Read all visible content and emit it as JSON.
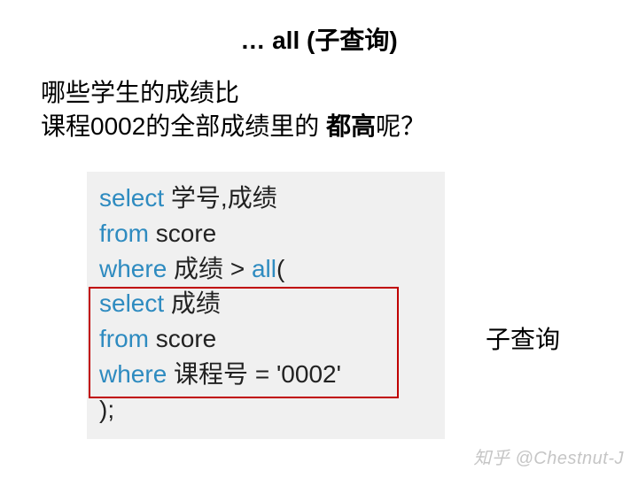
{
  "title": "… all (子查询)",
  "question": {
    "line1": "哪些学生的成绩比",
    "line2_prefix": "课程0002的全部成绩里的 ",
    "line2_bold": "都高",
    "line2_suffix": "呢？"
  },
  "code": {
    "l1_kw": "select",
    "l1_txt": " 学号,成绩",
    "l2_kw": "from",
    "l2_txt": " score",
    "l3_kw": "where",
    "l3_txt1": " 成绩 > ",
    "l3_kw2": "all",
    "l3_txt2": "(",
    "l4_kw": "select",
    "l4_txt": " 成绩",
    "l5_kw": "from",
    "l5_txt": " score",
    "l6_kw": "where",
    "l6_txt": " 课程号 = '0002'",
    "l7_txt": ");"
  },
  "annotation": "子查询",
  "watermark": "知乎 @Chestnut-J"
}
